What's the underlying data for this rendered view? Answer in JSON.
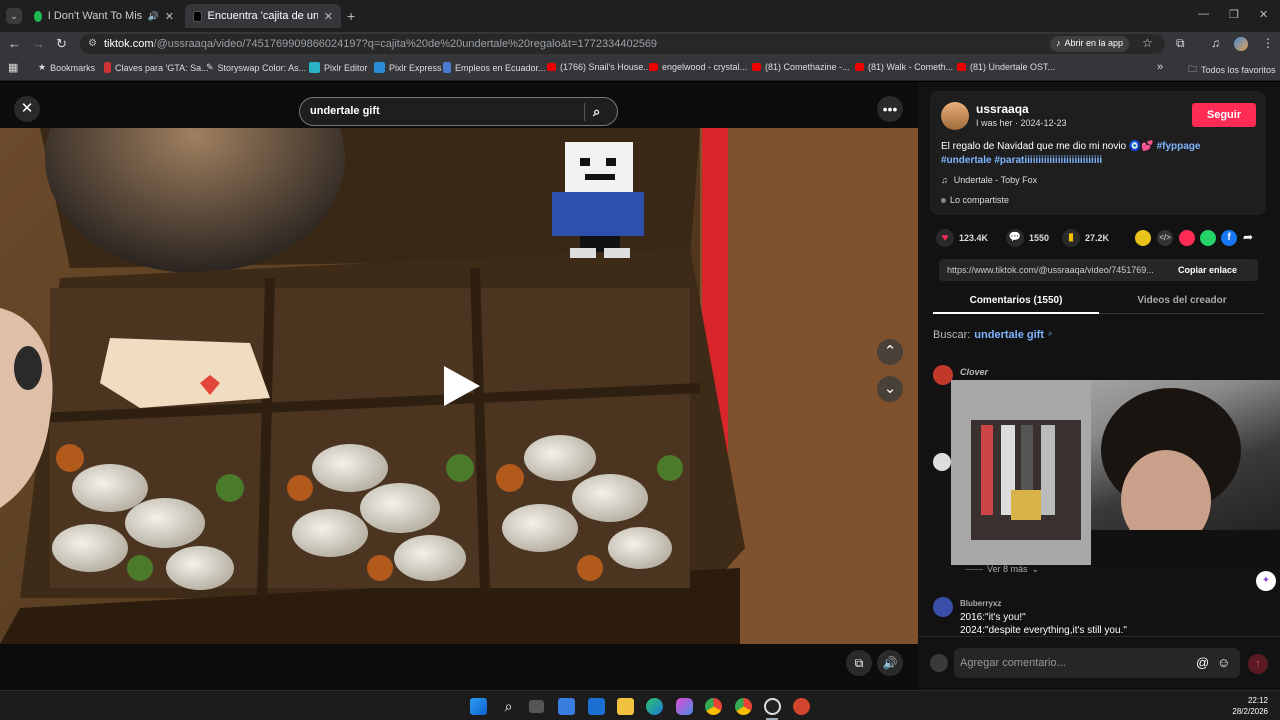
{
  "browser": {
    "tabs": [
      {
        "title": "I Don't Want To Miss A Thin",
        "active": false
      },
      {
        "title": "Encuentra 'cajita de undertale r",
        "active": true
      }
    ],
    "url_host": "tiktok.com",
    "url_rest": "/@ussraaqa/video/7451769909866024197?q=cajita%20de%20undertale%20regalo&t=1772334402569",
    "open_app": "Abrir en la app",
    "bookmarks": [
      "Bookmarks",
      "Claves para 'GTA: Sa...",
      "Storyswap Color: As...",
      "Pixlr Editor",
      "Pixlr Express",
      "Empleos en Ecuador...",
      "(1766) Snail's House...",
      "engelwood - crystal...",
      "(81) Comethazine -...",
      "(81) Walk - Cometh...",
      "(81) Undertale OST..."
    ],
    "all_favorites": "Todos los favoritos"
  },
  "video": {
    "search_text": "undertale gift"
  },
  "post": {
    "username": "ussraaqa",
    "subtitle": "I was her · 2024-12-23",
    "follow": "Seguir",
    "caption": "El regalo de Navidad que me dio mi novio 🧿💕",
    "hashtags_line1": "#fyppage",
    "hashtags_line2": "#undertale #paratiiiiiiiiiiiiiiiiiiiiiiiiiiii",
    "music": "Undertale - Toby Fox",
    "shared": "Lo compartiste",
    "likes": "123.4K",
    "comments": "1550",
    "saves": "27.2K",
    "link": "https://www.tiktok.com/@ussraaqa/video/7451769...",
    "copy_link": "Copiar enlace",
    "tab_comments": "Comentarios (1550)",
    "tab_videos": "Videos del creador",
    "search_label": "Buscar:",
    "search_term": "undertale gift",
    "comment1_user": "Clover",
    "see_more": "Ver 8 más",
    "comment2_user": "Bluberryxz",
    "comment2_line1": "2016:\"it's you!\"",
    "comment2_line2": "2024:\"despite everything,it's still you.\"",
    "add_comment": "Agregar comentario..."
  },
  "taskbar": {
    "time": "22:12",
    "date": "28/2/2026"
  },
  "colors": {
    "accent": "#fe2c55",
    "hashtag": "#7fb4ff"
  }
}
